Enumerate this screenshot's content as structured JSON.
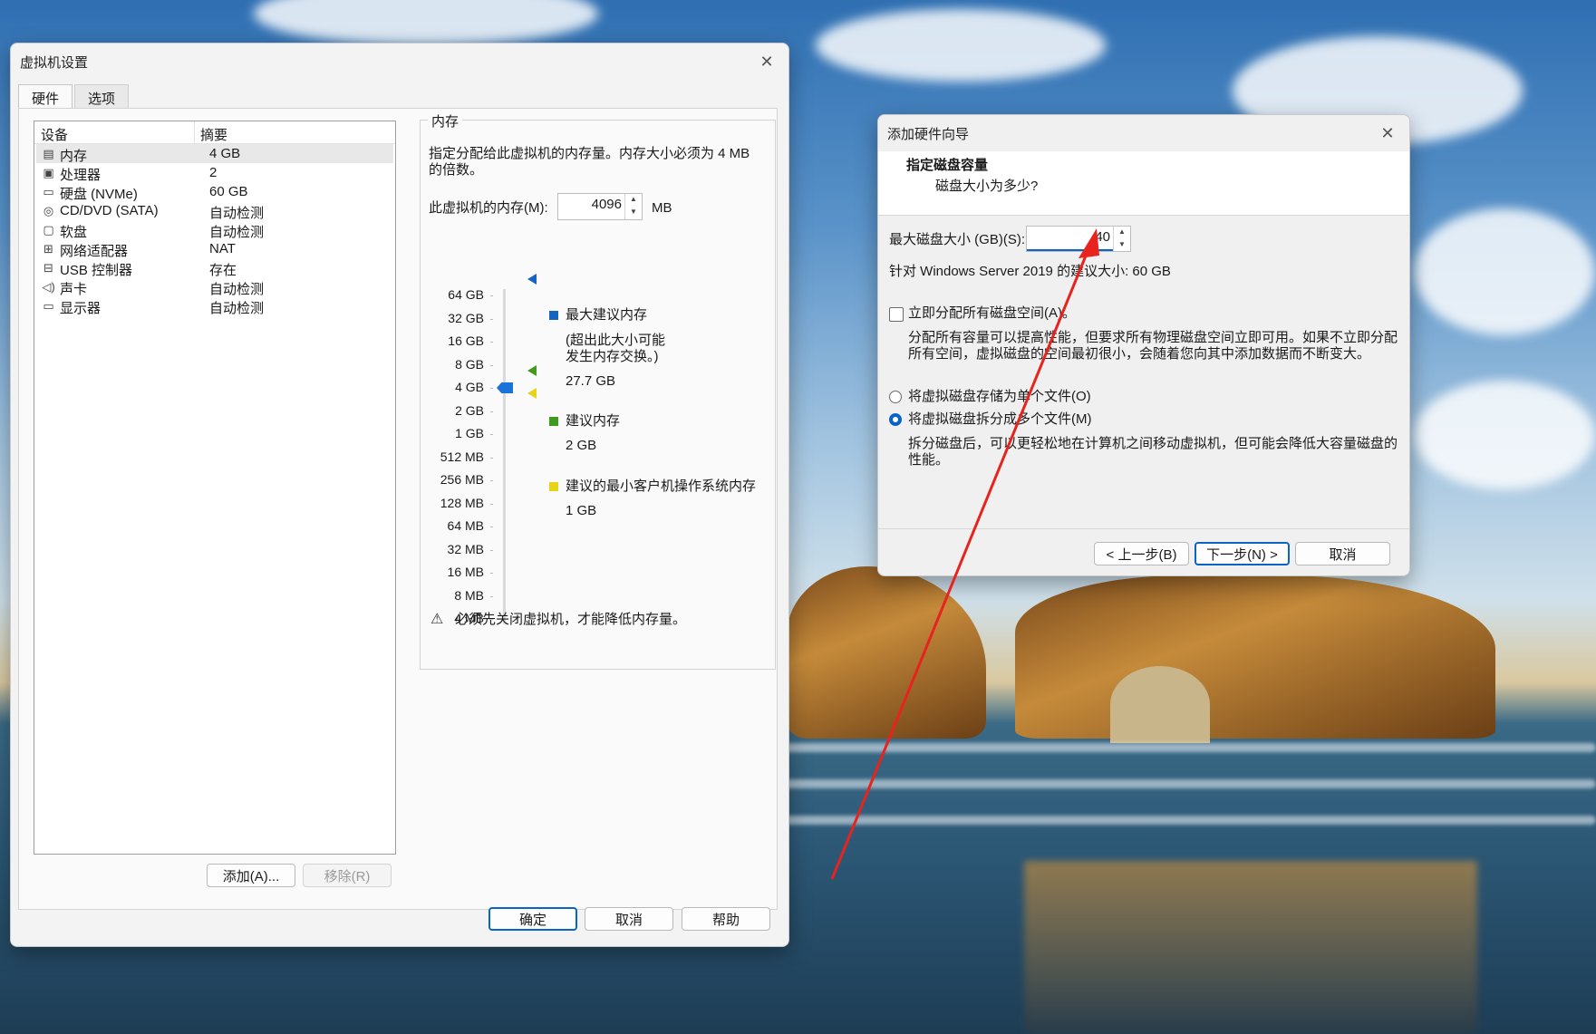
{
  "settings": {
    "title": "虚拟机设置",
    "close_glyph": "✕",
    "tabs": [
      "硬件",
      "选项"
    ],
    "columns": [
      "设备",
      "摘要"
    ],
    "devices": [
      {
        "name": "内存",
        "summary": "4 GB",
        "icon": "memory-icon"
      },
      {
        "name": "处理器",
        "summary": "2",
        "icon": "cpu-icon"
      },
      {
        "name": "硬盘 (NVMe)",
        "summary": "60 GB",
        "icon": "hard-disk-icon"
      },
      {
        "name": "CD/DVD (SATA)",
        "summary": "自动检测",
        "icon": "cd-dvd-icon"
      },
      {
        "name": "软盘",
        "summary": "自动检测",
        "icon": "floppy-icon"
      },
      {
        "name": "网络适配器",
        "summary": "NAT",
        "icon": "network-adapter-icon"
      },
      {
        "name": "USB 控制器",
        "summary": "存在",
        "icon": "usb-icon"
      },
      {
        "name": "声卡",
        "summary": "自动检测",
        "icon": "speaker-icon"
      },
      {
        "name": "显示器",
        "summary": "自动检测",
        "icon": "monitor-icon"
      }
    ],
    "add_button": "添加(A)...",
    "remove_button": "移除(R)",
    "memory": {
      "group_title": "内存",
      "description_line1": "指定分配给此虚拟机的内存量。内存大小必须为 4 MB",
      "description_line2": "的倍数。",
      "field_label": "此虚拟机的内存(M):",
      "value": "4096",
      "unit": "MB",
      "scale": [
        "64 GB",
        "32 GB",
        "16 GB",
        "8 GB",
        "4 GB",
        "2 GB",
        "1 GB",
        "512 MB",
        "256 MB",
        "128 MB",
        "64 MB",
        "32 MB",
        "16 MB",
        "8 MB",
        "4 MB"
      ],
      "max_recommended_label": "最大建议内存",
      "max_recommended_note_line1": "(超出此大小可能",
      "max_recommended_note_line2": "发生内存交换。)",
      "max_recommended_value": "27.7 GB",
      "recommended_label": "建议内存",
      "recommended_value": "2 GB",
      "min_guest_label": "建议的最小客户机操作系统内存",
      "min_guest_value": "1 GB",
      "warning": "必须先关闭虚拟机，才能降低内存量。",
      "colors": {
        "max": "#1565c0",
        "recommended": "#3f9a1d",
        "min": "#e8d21a"
      }
    },
    "ok_button": "确定",
    "cancel_button": "取消",
    "help_button": "帮助"
  },
  "wizard": {
    "title": "添加硬件向导",
    "close_glyph": "✕",
    "heading": "指定磁盘容量",
    "subheading": "磁盘大小为多少?",
    "max_size_label": "最大磁盘大小 (GB)(S):",
    "max_size_value": "40",
    "recommended_size": "针对 Windows Server 2019 的建议大小: 60 GB",
    "allocate_now_label": "立即分配所有磁盘空间(A)。",
    "allocate_now_desc_line1": "分配所有容量可以提高性能，但要求所有物理磁盘空间立即可用。如果不立即分配",
    "allocate_now_desc_line2": "所有空间，虚拟磁盘的空间最初很小，会随着您向其中添加数据而不断变大。",
    "single_file_label": "将虚拟磁盘存储为单个文件(O)",
    "split_file_label": "将虚拟磁盘拆分成多个文件(M)",
    "split_desc_line1": "拆分磁盘后，可以更轻松地在计算机之间移动虚拟机，但可能会降低大容量磁盘的",
    "split_desc_line2": "性能。",
    "back_button": "< 上一步(B)",
    "next_button": "下一步(N) >",
    "cancel_button": "取消"
  },
  "annotation": {
    "arrow_color": "#e8231e"
  }
}
